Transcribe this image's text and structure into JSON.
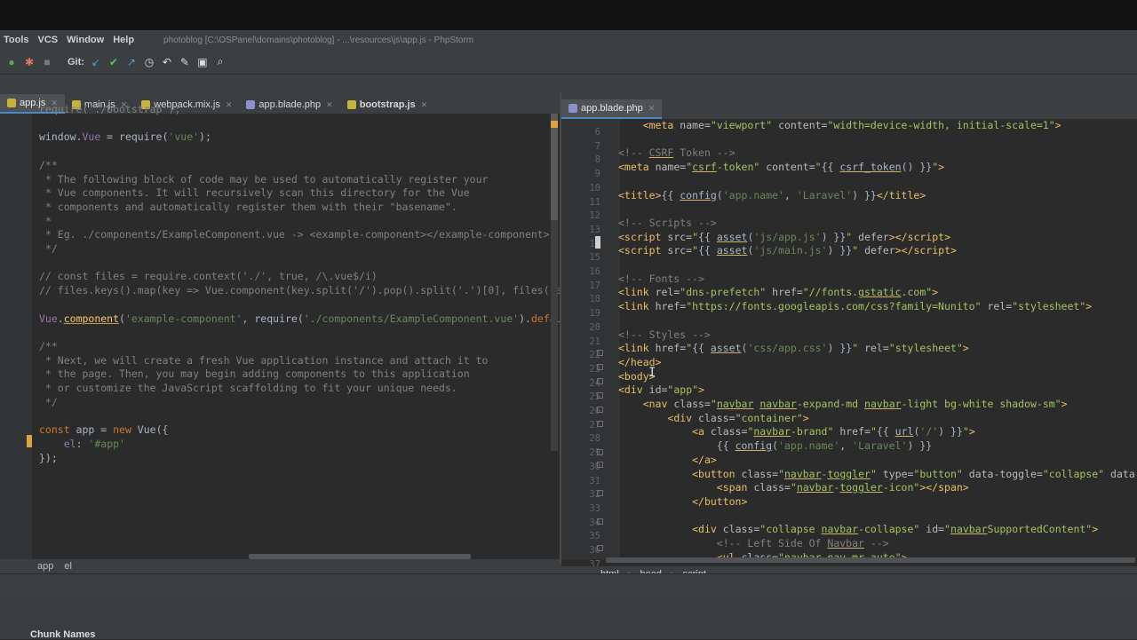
{
  "menu": {
    "items": [
      "Tools",
      "VCS",
      "Window",
      "Help"
    ],
    "window_title": "photoblog [C:\\OSPanel\\domains\\photoblog] - ...\\resources\\js\\app.js - PhpStorm"
  },
  "toolbar": {
    "git_label": "Git:",
    "icons": [
      "run-icon",
      "debug-icon",
      "stop-icon",
      "vcs-update-icon",
      "vcs-commit-icon",
      "vcs-push-icon",
      "history-icon",
      "revert-icon",
      "wrench-icon",
      "terminal-icon",
      "search-icon"
    ]
  },
  "tabs_left": [
    {
      "label": "app.js",
      "active": true,
      "color": "#c9b13a"
    },
    {
      "label": "main.js",
      "active": false,
      "color": "#c9b13a"
    },
    {
      "label": "webpack.mix.js",
      "active": false,
      "color": "#c9b13a"
    },
    {
      "label": "app.blade.php",
      "active": false,
      "color": "#8d8fd1"
    },
    {
      "label": "bootstrap.js",
      "active": false,
      "color": "#c9b13a"
    }
  ],
  "tabs_right": [
    {
      "label": "app.blade.php",
      "active": true,
      "color": "#8d8fd1"
    }
  ],
  "breadcrumb_left": [
    "app",
    "el"
  ],
  "breadcrumb_right": [
    "html",
    "head",
    "script"
  ],
  "bottom_panel": {
    "label": "Chunk Names"
  },
  "right_line_numbers": [
    "6",
    "7",
    "8",
    "9",
    "10",
    "11",
    "12",
    "13",
    "14",
    "15",
    "16",
    "17",
    "18",
    "19",
    "20",
    "21",
    "22",
    "23",
    "24",
    "25",
    "26",
    "27",
    "28",
    "29",
    "30",
    "31",
    "32",
    "33",
    "34",
    "35",
    "36",
    "37"
  ],
  "colors": {
    "keyword": "#cc7832",
    "string": "#6a8759",
    "comment": "#808080",
    "tag": "#e8bf6a",
    "attr_value": "#a5c261"
  }
}
